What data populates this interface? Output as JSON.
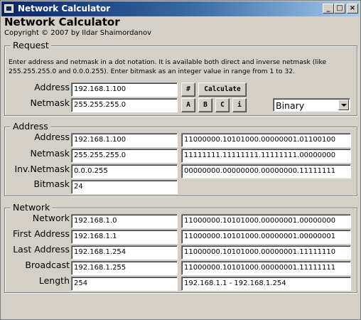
{
  "window": {
    "title": "Network Calculator",
    "controls": {
      "minimize": "_",
      "maximize": "□",
      "close": "×"
    }
  },
  "header": {
    "title": "Network Calculator",
    "copyright": "Copyright © 2007 by Ildar Shaimordanov"
  },
  "request": {
    "legend": "Request",
    "description": "Enter address and netmask in a dot notation. It is available both direct and inverse netmask (like 255.255.255.0 and 0.0.0.255). Enter bitmask as an integer value in range from 1 to 32.",
    "address_label": "Address",
    "address_value": "192.168.1.100",
    "netmask_label": "Netmask",
    "netmask_value": "255.255.255.0",
    "hash_button": "#",
    "calculate_button": "Calculate",
    "class_buttons": [
      "A",
      "B",
      "C",
      "i"
    ],
    "format_select": "Binary"
  },
  "address": {
    "legend": "Address",
    "rows": [
      {
        "label": "Address",
        "value": "192.168.1.100",
        "binary": "11000000.10101000.00000001.01100100"
      },
      {
        "label": "Netmask",
        "value": "255.255.255.0",
        "binary": "11111111.11111111.11111111.00000000"
      },
      {
        "label": "Inv.Netmask",
        "value": "0.0.0.255",
        "binary": "00000000.00000000.00000000.11111111"
      },
      {
        "label": "Bitmask",
        "value": "24"
      }
    ]
  },
  "network": {
    "legend": "Network",
    "rows": [
      {
        "label": "Network",
        "value": "192.168.1.0",
        "binary": "11000000.10101000.00000001.00000000"
      },
      {
        "label": "First Address",
        "value": "192.168.1.1",
        "binary": "11000000.10101000.00000001.00000001"
      },
      {
        "label": "Last Address",
        "value": "192.168.1.254",
        "binary": "11000000.10101000.00000001.11111110"
      },
      {
        "label": "Broadcast",
        "value": "192.168.1.255",
        "binary": "11000000.10101000.00000001.11111111"
      },
      {
        "label": "Length",
        "value": "254",
        "binary": "192.168.1.1 - 192.168.1.254"
      }
    ]
  }
}
